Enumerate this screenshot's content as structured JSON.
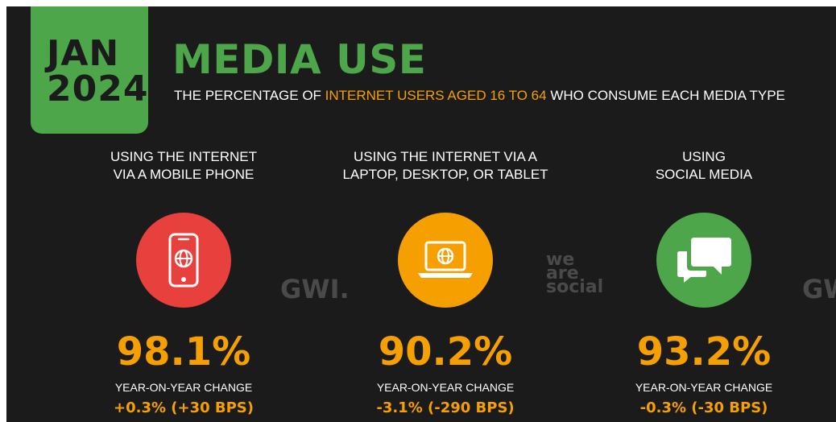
{
  "header": {
    "date_month": "JAN",
    "date_year": "2024",
    "title": "MEDIA USE",
    "subtitle_pre": "THE PERCENTAGE OF ",
    "subtitle_highlight": "INTERNET USERS AGED 16 TO 64",
    "subtitle_post": " WHO CONSUME EACH MEDIA TYPE"
  },
  "watermarks": {
    "gwi": "GWI.",
    "gwi_right": "GW",
    "we": "we",
    "are": "are",
    "social": "social"
  },
  "stats": [
    {
      "label": "USING THE INTERNET\nVIA A MOBILE PHONE",
      "icon": "mobile-phone-icon",
      "color": "#e8403c",
      "value": "98.1%",
      "change_label": "YEAR-ON-YEAR CHANGE",
      "change": "+0.3% (+30 BPS)"
    },
    {
      "label": "USING THE INTERNET VIA A\nLAPTOP, DESKTOP, OR TABLET",
      "icon": "laptop-icon",
      "color": "#f5a000",
      "value": "90.2%",
      "change_label": "YEAR-ON-YEAR CHANGE",
      "change": "-3.1% (-290 BPS)"
    },
    {
      "label": "USING\nSOCIAL MEDIA",
      "icon": "chat-bubbles-icon",
      "color": "#4da64a",
      "value": "93.2%",
      "change_label": "YEAR-ON-YEAR CHANGE",
      "change": "-0.3% (-30 BPS)"
    }
  ]
}
